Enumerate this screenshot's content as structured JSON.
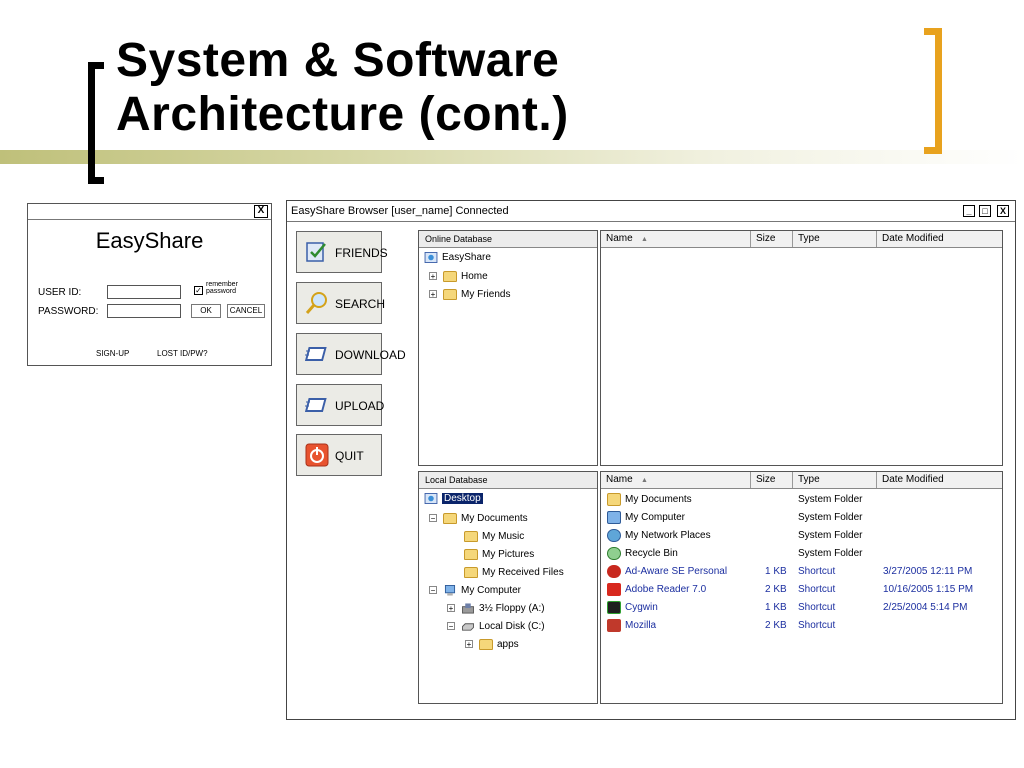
{
  "slide": {
    "title_line1": "System & Software",
    "title_line2": "Architecture (cont.)"
  },
  "login": {
    "close_label": "X",
    "app_name": "EasyShare",
    "user_label": "USER ID:",
    "password_label": "PASSWORD:",
    "remember_label": "remember password",
    "remember_checked": true,
    "check_mark": "✓",
    "ok_label": "OK",
    "cancel_label": "CANCEL",
    "signup_label": "SIGN-UP",
    "lost_label": "LOST ID/PW?"
  },
  "browser": {
    "title": "EasyShare Browser [user_name] Connected",
    "controls": {
      "minimize": "_",
      "maximize": "□",
      "close": "X"
    },
    "side_buttons": [
      {
        "label": "FRIENDS",
        "icon": "friends-icon"
      },
      {
        "label": "SEARCH",
        "icon": "search-icon"
      },
      {
        "label": "DOWNLOAD",
        "icon": "download-icon"
      },
      {
        "label": "UPLOAD",
        "icon": "upload-icon"
      },
      {
        "label": "QUIT",
        "icon": "power-icon"
      }
    ],
    "online": {
      "header": "Online Database",
      "tree": [
        {
          "label": "EasyShare",
          "icon": "easyshare-icon"
        },
        {
          "label": "Home",
          "expander": "+",
          "icon": "folder-icon"
        },
        {
          "label": "My Friends",
          "expander": "+",
          "icon": "folder-icon"
        }
      ]
    },
    "columns": {
      "name": "Name",
      "sort": "▲",
      "size": "Size",
      "type": "Type",
      "modified": "Date Modified"
    },
    "local": {
      "header": "Local Database",
      "tree": [
        {
          "label": "Desktop",
          "icon": "desktop-icon",
          "selected": true
        },
        {
          "label": "My Documents",
          "expander": "−",
          "icon": "folder-icon"
        },
        {
          "label": "My Music",
          "icon": "music-folder-icon"
        },
        {
          "label": "My Pictures",
          "icon": "pictures-folder-icon"
        },
        {
          "label": "My Received Files",
          "icon": "folder-icon"
        },
        {
          "label": "My Computer",
          "expander": "−",
          "icon": "computer-icon"
        },
        {
          "label": "3½ Floppy (A:)",
          "expander": "+",
          "icon": "floppy-icon"
        },
        {
          "label": "Local Disk (C:)",
          "expander": "−",
          "icon": "disk-icon"
        },
        {
          "label": "apps",
          "expander": "+",
          "icon": "folder-icon"
        }
      ],
      "files": [
        {
          "name": "My Documents",
          "size": "",
          "type": "System Folder",
          "modified": "",
          "icon": "folder-icon",
          "color": "#000000"
        },
        {
          "name": "My Computer",
          "size": "",
          "type": "System Folder",
          "modified": "",
          "icon": "computer-icon",
          "color": "#000000"
        },
        {
          "name": "My Network Places",
          "size": "",
          "type": "System Folder",
          "modified": "",
          "icon": "network-icon",
          "color": "#000000"
        },
        {
          "name": "Recycle Bin",
          "size": "",
          "type": "System Folder",
          "modified": "",
          "icon": "recycle-icon",
          "color": "#000000"
        },
        {
          "name": "Ad-Aware SE Personal",
          "size": "1 KB",
          "type": "Shortcut",
          "modified": "3/27/2005 12:11 PM",
          "icon": "adaware-icon",
          "color": "#1c2fa0"
        },
        {
          "name": "Adobe Reader 7.0",
          "size": "2 KB",
          "type": "Shortcut",
          "modified": "10/16/2005 1:15 PM",
          "icon": "adobe-icon",
          "color": "#1c2fa0"
        },
        {
          "name": "Cygwin",
          "size": "1 KB",
          "type": "Shortcut",
          "modified": "2/25/2004 5:14 PM",
          "icon": "cygwin-icon",
          "color": "#1c2fa0"
        },
        {
          "name": "Mozilla",
          "size": "2 KB",
          "type": "Shortcut",
          "modified": "",
          "icon": "mozilla-icon",
          "color": "#1c2fa0"
        }
      ]
    }
  }
}
